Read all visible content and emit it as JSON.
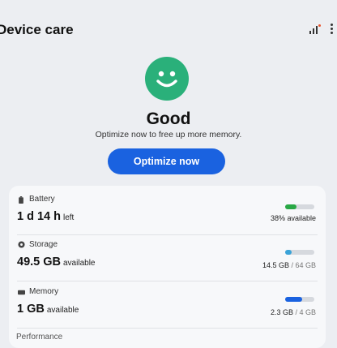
{
  "header": {
    "title": "Device care",
    "stats_icon": "bar-chart-icon",
    "more_icon": "more-vertical-icon"
  },
  "status": {
    "icon": "smiley-face-icon",
    "title": "Good",
    "subtitle": "Optimize now to free up more memory.",
    "button_label": "Optimize now"
  },
  "items": {
    "battery": {
      "label": "Battery",
      "value_main": "1 d 14 h",
      "value_unit": "left",
      "level": 0.38,
      "meta": "38% available",
      "color": "#29a845",
      "icon": "battery-icon"
    },
    "storage": {
      "label": "Storage",
      "value_main": "49.5 GB",
      "value_unit": "available",
      "level": 0.23,
      "used": "14.5 GB",
      "total": "/ 64 GB",
      "color": "#3aa3d8",
      "icon": "storage-icon"
    },
    "memory": {
      "label": "Memory",
      "value_main": "1 GB",
      "value_unit": "available",
      "level": 0.58,
      "used": "2.3 GB",
      "total": "/ 4 GB",
      "color": "#1a62e0",
      "icon": "memory-chip-icon"
    }
  },
  "next_item_label": "Performance"
}
